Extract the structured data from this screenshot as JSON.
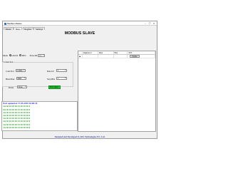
{
  "window": {
    "title": "Modbus Master"
  },
  "tabs": [
    {
      "label": "Master",
      "active": false
    },
    {
      "label": "Slave",
      "active": true
    },
    {
      "label": "Register",
      "active": false
    },
    {
      "label": "Settings",
      "active": false
    }
  ],
  "heading": "MODBUS SLAVE",
  "mode": {
    "label": "Mode",
    "options": [
      {
        "label": "ASCII",
        "selected": true
      },
      {
        "label": "RTU",
        "selected": false
      }
    ],
    "slave_id_label": "Slave ID",
    "slave_id_value": "13"
  },
  "connection": {
    "title": "Connection",
    "com_port_label": "Com Port",
    "com_port_value": "COM4",
    "data_bit_label": "Data bit",
    "data_bit_value": "7",
    "baud_rate_label": "Baud Rate",
    "baud_rate_value": "9600",
    "stop_bits_label": "Stop Bits",
    "stop_bits_value": "1",
    "parity_label": "Parity",
    "parity_value": "None",
    "port_open_label": "Port Open"
  },
  "log": {
    "heading": "Port opened at 17-05-2019 16:00:35",
    "lines": [
      "3A 30 44 20 30 33 20 30 30 0",
      "0A 30 44 20 30 33 20 30 30 0",
      "3A 30 44 20 30 33 20 30 30 0",
      "3A 30 44 20 30 33 20 30 30 0",
      "3A 30 44 20 30 33 20 30 30 0",
      "3A 30 44 20 30 33 20 30 30 0",
      "3A 30 44 20 30 33 20 30 30 0",
      "3A 30 44 20 30 33 20 30 30 0"
    ]
  },
  "table": {
    "columns": [
      "",
      "Register #",
      "Data",
      "Hex",
      "SET"
    ],
    "row_marker": "▶",
    "update_label": "Update"
  },
  "footer": "Designed and Developed by RSL Technologies Pvt. Ltd.",
  "colors": {
    "port_open": "#22c233",
    "log_heading": "#1b1bcf",
    "log_text": "#229922",
    "footer": "#3a44a6"
  }
}
